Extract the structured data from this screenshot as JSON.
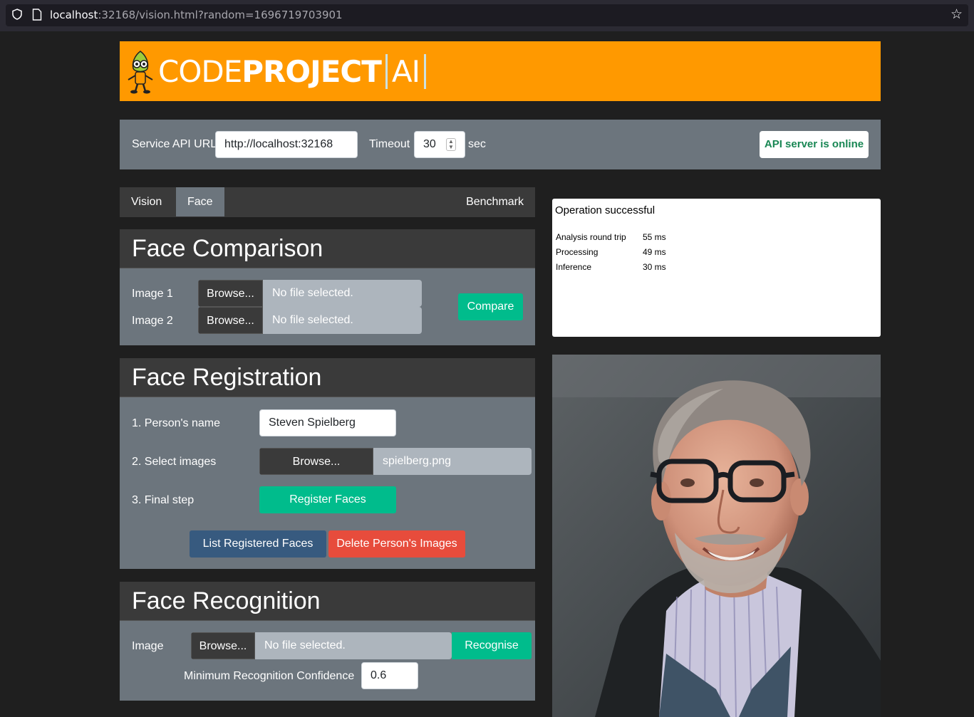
{
  "browser": {
    "url_host": "localhost",
    "url_rest": ":32168/vision.html?random=1696719703901"
  },
  "banner": {
    "logo_code": "CODE",
    "logo_project": "PROJECT",
    "logo_ai": "AI"
  },
  "config": {
    "service_url_label": "Service API URL",
    "service_url_value": "http://localhost:32168",
    "timeout_label": "Timeout",
    "timeout_value": "30",
    "timeout_unit": "sec",
    "status": "API server is online",
    "status_color": "#198754"
  },
  "tabs": [
    {
      "label": "Vision"
    },
    {
      "label": "Face",
      "active": true
    },
    {
      "label": "Benchmark"
    }
  ],
  "face_comparison": {
    "title": "Face Comparison",
    "image1_label": "Image 1",
    "image2_label": "Image 2",
    "browse_label": "Browse...",
    "image1_file": "No file selected.",
    "image2_file": "No file selected.",
    "compare_label": "Compare"
  },
  "face_registration": {
    "title": "Face Registration",
    "name_label": "1. Person's name",
    "name_value": "Steven Spielberg",
    "images_label": "2. Select images",
    "browse_label": "Browse...",
    "images_file": "spielberg.png",
    "final_label": "3. Final step",
    "register_label": "Register Faces",
    "list_label": "List Registered Faces",
    "delete_label": "Delete Person's Images"
  },
  "face_recognition": {
    "title": "Face Recognition",
    "image_label": "Image",
    "browse_label": "Browse...",
    "image_file": "No file selected.",
    "recognise_label": "Recognise",
    "confidence_label": "Minimum Recognition Confidence",
    "confidence_value": "0.6"
  },
  "results": {
    "message": "Operation successful",
    "rows": [
      {
        "key": "Analysis round trip",
        "value": "55 ms"
      },
      {
        "key": "Processing",
        "value": "49 ms"
      },
      {
        "key": "Inference",
        "value": "30 ms"
      }
    ]
  },
  "colors": {
    "brand_orange": "#ff9900",
    "success_green": "#00bc8c",
    "primary_blue": "#375a7f",
    "danger_red": "#e74c3c"
  }
}
